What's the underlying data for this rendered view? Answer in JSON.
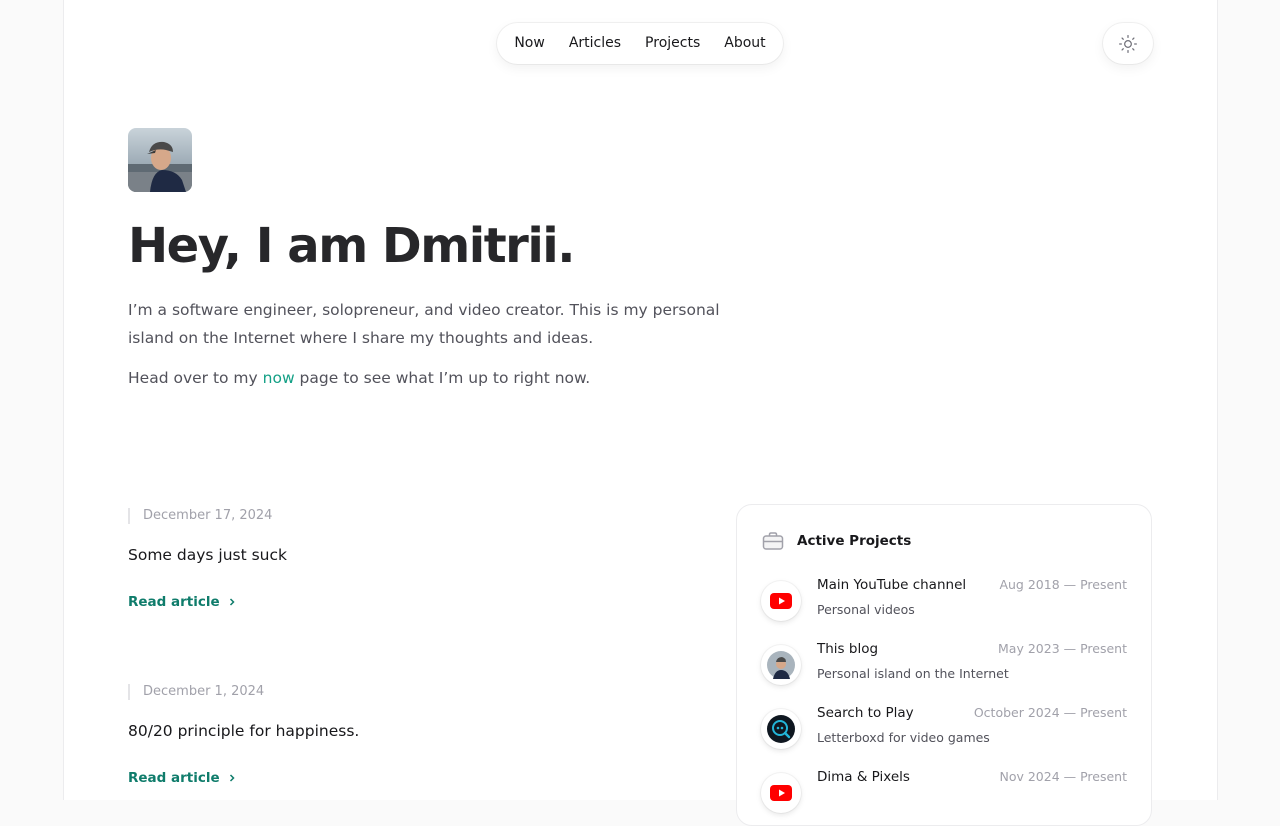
{
  "nav": {
    "items": [
      "Now",
      "Articles",
      "Projects",
      "About"
    ]
  },
  "theme_toggle": {
    "icon": "sun-icon"
  },
  "hero": {
    "avatar": "profile-photo",
    "title": "Hey, I am Dmitrii.",
    "intro": "I’m a software engineer, solopreneur, and video creator. This is my personal island on the Internet where I share my thoughts and ideas.",
    "now_prefix": "Head over to my ",
    "now_link": "now",
    "now_suffix": " page to see what I’m up to right now."
  },
  "articles": [
    {
      "date": "December 17, 2024",
      "title": "Some days just suck",
      "cta": "Read article"
    },
    {
      "date": "December 1, 2024",
      "title": "80/20 principle for happiness.",
      "cta": "Read article"
    }
  ],
  "projects": {
    "heading": "Active Projects",
    "icon": "briefcase-icon",
    "items": [
      {
        "name": "Main YouTube channel",
        "description": "Personal videos",
        "period": "Aug 2018 — Present",
        "icon": "youtube-icon"
      },
      {
        "name": "This blog",
        "description": "Personal island on the Internet",
        "period": "May 2023 — Present",
        "icon": "avatar-icon"
      },
      {
        "name": "Search to Play",
        "description": "Letterboxd for video games",
        "period": "October 2024 — Present",
        "icon": "search-to-play-icon"
      },
      {
        "name": "Dima & Pixels",
        "description": "",
        "period": "Nov 2024 — Present",
        "icon": "youtube-icon"
      }
    ]
  },
  "colors": {
    "accent": "#14a086",
    "cta": "#0f7c6b",
    "youtube": "#ff0000"
  }
}
